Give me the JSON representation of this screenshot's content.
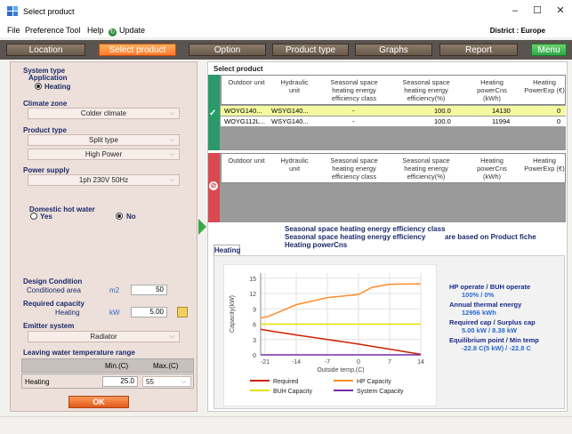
{
  "window": {
    "title": "Select product",
    "minimize": "–",
    "maximize": "☐",
    "close": "✕"
  },
  "menu": {
    "items": [
      "File",
      "Preference",
      "Tool",
      "Help"
    ],
    "update": "Update",
    "district": "District : Europe"
  },
  "tabs": [
    "Location",
    "Select product",
    "Option",
    "Product type",
    "Graphs",
    "Report",
    "Menu"
  ],
  "left": {
    "system_type": "System type",
    "application": "Application",
    "heating": "Heating",
    "climate_zone": "Climate zone",
    "climate_value": "Colder climate",
    "product_type": "Product type",
    "product_value1": "Split type",
    "product_value2": "High Power",
    "power_supply": "Power supply",
    "power_value": "1ph 230V 50Hz",
    "dhw": "Domestic hot water",
    "yes": "Yes",
    "no": "No",
    "design_condition": "Design Condition",
    "conditioned_area": "Conditioned area",
    "area_unit": "m2",
    "area_value": "50",
    "required_capacity": "Required capacity",
    "heating_label": "Heating",
    "cap_unit": "kW",
    "cap_value": "5.00",
    "emitter_system": "Emitter system",
    "emitter_value": "Radiator",
    "lwt_range": "Leaving water temperature range",
    "min_c": "Min.(C)",
    "max_c": "Max.(C)",
    "lwt_row": "Heating",
    "lwt_min": "25.0",
    "lwt_max": "55",
    "ok": "OK"
  },
  "grid": {
    "title": "Select product",
    "headers": [
      "Outdoor unit",
      "Hydraulic unit",
      "Seasonal space heating energy efficiency class",
      "Seasonal space heating energy efficiency(%)",
      "Heating powerCns (kWh)",
      "Heating PowerExp (€)"
    ],
    "rows": [
      [
        "WOYG140...",
        "WSYG140...",
        "-",
        "100.0",
        "14130",
        "0"
      ],
      [
        "WOYG112L...",
        "WSYG140...",
        "-",
        "100.0",
        "11994",
        "0"
      ]
    ]
  },
  "notes": {
    "line1": "Seasonal space heating energy efficiency class",
    "line2": "Seasonal space heating energy efficiency",
    "line3": "Heating powerCns",
    "basis": "are based on Product fiche"
  },
  "chart_tab": "Heating",
  "chart_data": {
    "type": "line",
    "xlabel": "Outside temp.(C)",
    "ylabel": "Capacity(kW)",
    "x_ticks": [
      "-21",
      "-14",
      "-7",
      "0",
      "7",
      "14"
    ],
    "y_ticks": [
      "0",
      "3",
      "6",
      "9",
      "12",
      "15"
    ],
    "xlim": [
      -22,
      14
    ],
    "ylim": [
      0,
      16
    ],
    "series": [
      {
        "name": "Required",
        "color": "#cc2200",
        "points": [
          [
            -22,
            5.0
          ],
          [
            -20,
            4.7
          ],
          [
            -14,
            3.9
          ],
          [
            -7,
            3.0
          ],
          [
            0,
            2.1
          ],
          [
            7,
            1.1
          ],
          [
            14,
            0.1
          ]
        ]
      },
      {
        "name": "HP Capacity",
        "color": "#ff8c2a",
        "points": [
          [
            -22,
            7.2
          ],
          [
            -20,
            7.6
          ],
          [
            -14,
            9.8
          ],
          [
            -7,
            11.2
          ],
          [
            0,
            11.8
          ],
          [
            3,
            13.2
          ],
          [
            7,
            13.8
          ],
          [
            14,
            13.9
          ]
        ]
      },
      {
        "name": "BUH Capacity",
        "color": "#e8e000",
        "points": [
          [
            -22,
            6.0
          ],
          [
            14,
            6.0
          ]
        ]
      },
      {
        "name": "System Capacity",
        "color": "#7a2aaa",
        "points": [
          [
            -22,
            0
          ],
          [
            14,
            0
          ]
        ]
      }
    ]
  },
  "stats": {
    "k1": "HP operate / BUH operate",
    "v1": "100% / 0%",
    "k2": "Annual thermal energy",
    "v2": "12956 kWh",
    "k3": "Required cap / Surplus cap",
    "v3": "5.00 kW / 8.38 kW",
    "k4": "Equilibrium point / Min temp",
    "v4": "-22.8 C(5 kW) / -22.8 C"
  }
}
